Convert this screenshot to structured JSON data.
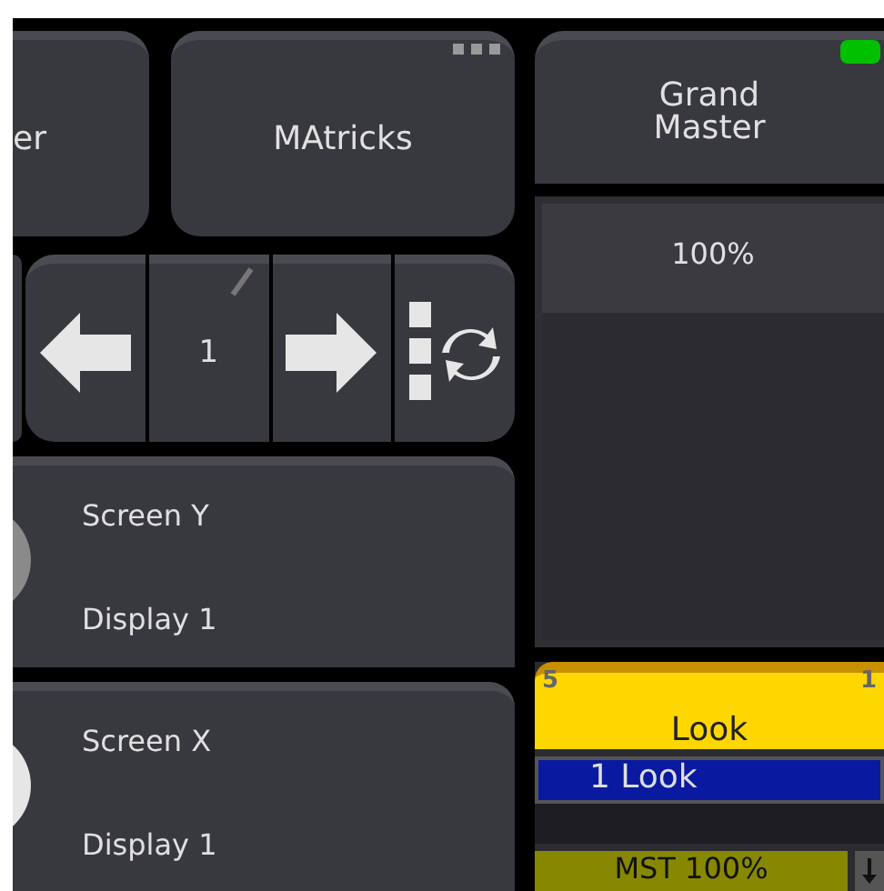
{
  "buttons": [
    {
      "label": "er",
      "menu": false
    },
    {
      "label": "MAtricks",
      "menu": true
    }
  ],
  "pager": {
    "page": "1"
  },
  "encoders": [
    {
      "name": "Screen Y",
      "display": "Display 1",
      "active": false
    },
    {
      "name": "Screen X",
      "display": "Display 1",
      "active": true
    }
  ],
  "grand_master": {
    "title": "Grand Master",
    "value": "100%",
    "on": true
  },
  "executor": {
    "number": "5",
    "page": "1",
    "name": "Look",
    "cue": "1 Look",
    "master": "MST 100%"
  }
}
